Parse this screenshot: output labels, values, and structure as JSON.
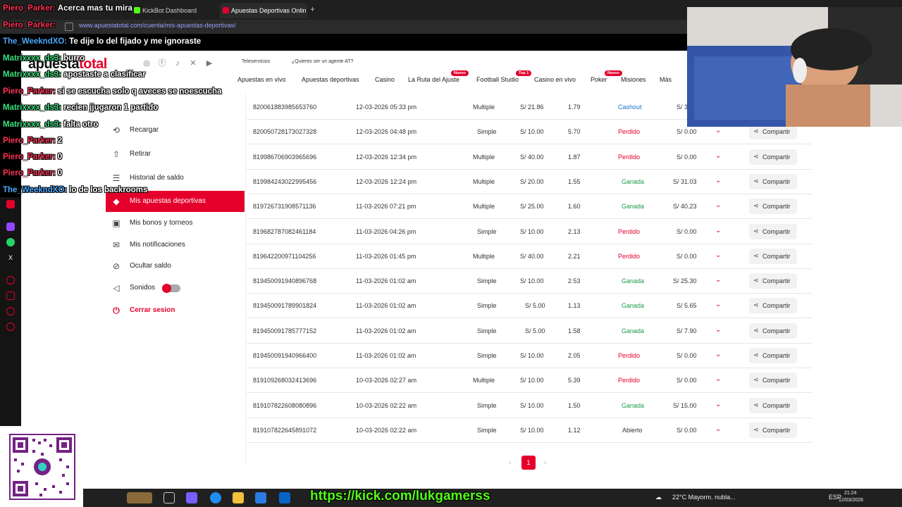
{
  "browser": {
    "tabs": [
      {
        "label": "KickBot Dashboard",
        "active": false
      },
      {
        "label": "Apuestas Deportivas Onlin",
        "active": true
      }
    ],
    "url": "www.apuestatotal.com/cuenta/mis-apuestas-deportivas/"
  },
  "site": {
    "logo_a": "apuesta",
    "logo_b": "total",
    "teleservicios": "Teleservicios",
    "agent": "¿Quieres ser un agente AT?",
    "nav": [
      {
        "label": "Apuestas en vivo"
      },
      {
        "label": "Apuestas deportivas"
      },
      {
        "label": "Casino"
      },
      {
        "label": "La Ruta del Ajuste",
        "badge": "Nuevo"
      },
      {
        "label": "Football Studio",
        "badge": "Top 1"
      },
      {
        "label": "Casino en vivo"
      },
      {
        "label": "Poker",
        "badge": "Nuevo"
      },
      {
        "label": "Misiones"
      },
      {
        "label": "Más"
      }
    ]
  },
  "sidebar": {
    "items": [
      {
        "label": "Recargar",
        "icon": "recharge-icon"
      },
      {
        "label": "Retirar",
        "icon": "withdraw-icon"
      },
      {
        "label": "Historial de saldo",
        "icon": "history-icon"
      },
      {
        "label": "Mis apuestas deportivas",
        "icon": "ticket-icon",
        "active": true
      },
      {
        "label": "Mis bonos y torneos",
        "icon": "gift-icon"
      },
      {
        "label": "Mis notificaciones",
        "icon": "mail-icon"
      },
      {
        "label": "Ocultar saldo",
        "icon": "eye-off-icon"
      },
      {
        "label": "Sonidos",
        "icon": "speaker-icon",
        "toggle": true
      },
      {
        "label": "Cerrar sesion",
        "icon": "power-icon",
        "logout": true
      }
    ]
  },
  "bets": {
    "share_label": "Compartir",
    "rows": [
      {
        "id": "820061883985653760",
        "date": "12-03-2026 05:33 pm",
        "type": "Multiple",
        "amount": "S/ 21.86",
        "odds": "1.79",
        "status": "Cashout",
        "kind": "cash",
        "win": "S/ 3"
      },
      {
        "id": "820050728173027328",
        "date": "12-03-2026 04:48 pm",
        "type": "Simple",
        "amount": "S/ 10.00",
        "odds": "5.70",
        "status": "Perdido",
        "kind": "lost",
        "win": "S/ 0.00"
      },
      {
        "id": "819986706903965696",
        "date": "12-03-2026 12:34 pm",
        "type": "Multiple",
        "amount": "S/ 40.00",
        "odds": "1.87",
        "status": "Perdido",
        "kind": "lost",
        "win": "S/ 0.00"
      },
      {
        "id": "819984243022995456",
        "date": "12-03-2026 12:24 pm",
        "type": "Multiple",
        "amount": "S/ 20.00",
        "odds": "1.55",
        "status": "Ganada",
        "kind": "won",
        "win": "S/ 31.03"
      },
      {
        "id": "819726731908571136",
        "date": "11-03-2026 07:21 pm",
        "type": "Multiple",
        "amount": "S/ 25.00",
        "odds": "1.60",
        "status": "Ganada",
        "kind": "won",
        "win": "S/ 40.23"
      },
      {
        "id": "819682787082461184",
        "date": "11-03-2026 04:26 pm",
        "type": "Simple",
        "amount": "S/ 10.00",
        "odds": "2.13",
        "status": "Perdido",
        "kind": "lost",
        "win": "S/ 0.00"
      },
      {
        "id": "819642200971104256",
        "date": "11-03-2026 01:45 pm",
        "type": "Multiple",
        "amount": "S/ 40.00",
        "odds": "2.21",
        "status": "Perdido",
        "kind": "lost",
        "win": "S/ 0.00"
      },
      {
        "id": "819450091940896768",
        "date": "11-03-2026 01:02 am",
        "type": "Simple",
        "amount": "S/ 10.00",
        "odds": "2.53",
        "status": "Ganada",
        "kind": "won",
        "win": "S/ 25.30"
      },
      {
        "id": "819450091789901824",
        "date": "11-03-2026 01:02 am",
        "type": "Simple",
        "amount": "S/ 5.00",
        "odds": "1.13",
        "status": "Ganada",
        "kind": "won",
        "win": "S/ 5.65"
      },
      {
        "id": "819450091785777152",
        "date": "11-03-2026 01:02 am",
        "type": "Simple",
        "amount": "S/ 5.00",
        "odds": "1.58",
        "status": "Ganada",
        "kind": "won",
        "win": "S/ 7.90"
      },
      {
        "id": "819450091940966400",
        "date": "11-03-2026 01:02 am",
        "type": "Simple",
        "amount": "S/ 10.00",
        "odds": "2.05",
        "status": "Perdido",
        "kind": "lost",
        "win": "S/ 0.00",
        "gift": true
      },
      {
        "id": "819109268032413696",
        "date": "10-03-2026 02:27 am",
        "type": "Multiple",
        "amount": "S/ 10.00",
        "odds": "5.39",
        "status": "Perdido",
        "kind": "lost",
        "win": "S/ 0.00"
      },
      {
        "id": "819107822608080896",
        "date": "10-03-2026 02:22 am",
        "type": "Simple",
        "amount": "S/ 10.00",
        "odds": "1.50",
        "status": "Ganada",
        "kind": "won",
        "win": "S/ 15.00"
      },
      {
        "id": "819107822645891072",
        "date": "10-03-2026 02:22 am",
        "type": "Simple",
        "amount": "S/ 10.00",
        "odds": "1.12",
        "status": "Abierto",
        "kind": "open",
        "win": "S/ 0.00"
      }
    ],
    "page": "1"
  },
  "chat": [
    {
      "user": "Piero_Parker:",
      "color": "red",
      "msg": "Acerca mas tu mira"
    },
    {
      "user": "Piero_Parker:",
      "color": "red",
      "msg": ""
    },
    {
      "user": "The_WeekndXO:",
      "color": "blue",
      "msg": "Te dije lo del fijado y me ignoraste"
    },
    {
      "user": "Matrixxxx_ds3:",
      "color": "green",
      "msg": "burro"
    },
    {
      "user": "Matrixxxx_ds3:",
      "color": "green",
      "msg": "apostaste a clasificar"
    },
    {
      "user": "Piero_Parker:",
      "color": "red",
      "msg": "si se escucha solo q aveces se noescucha"
    },
    {
      "user": "Matrixxxx_ds3:",
      "color": "green",
      "msg": "recien jjugaron 1 partido"
    },
    {
      "user": "Matrixxxx_ds3:",
      "color": "green",
      "msg": "falta otro"
    },
    {
      "user": "Piero_Parker:",
      "color": "red",
      "msg": "2"
    },
    {
      "user": "Piero_Parker:",
      "color": "red",
      "msg": "0"
    },
    {
      "user": "Piero_Parker:",
      "color": "red",
      "msg": "0"
    },
    {
      "user": "The_WeekndXO:",
      "color": "blue",
      "msg": "lo de los backrooms"
    }
  ],
  "stream": {
    "kick_url": "https://kick.com/lukgamerss"
  },
  "taskbar": {
    "weather": "22°C  Mayorm. nubla...",
    "lang": "ESP",
    "time": "21:24",
    "date": "12/03/2026"
  }
}
